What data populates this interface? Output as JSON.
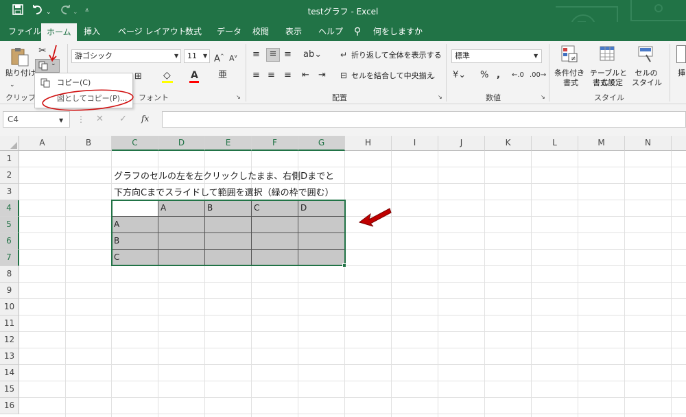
{
  "title": {
    "text": "testグラフ  -  Excel"
  },
  "quick_access": {
    "save_icon": "save-icon",
    "undo_icon": "undo-icon",
    "redo_icon": "redo-icon",
    "customize_icon": "customize-icon"
  },
  "tabs": [
    {
      "label": "ファイル"
    },
    {
      "label": "ホーム"
    },
    {
      "label": "挿入"
    },
    {
      "label": "ページ レイアウト"
    },
    {
      "label": "数式"
    },
    {
      "label": "データ"
    },
    {
      "label": "校閲"
    },
    {
      "label": "表示"
    },
    {
      "label": "ヘルプ"
    },
    {
      "label": "何をしますか"
    }
  ],
  "ribbon": {
    "clipboard": {
      "paste_label": "貼り付け",
      "group_label": "クリップボード"
    },
    "font": {
      "font_name": "游ゴシック",
      "font_size": "11",
      "group_label": "フォント"
    },
    "alignment": {
      "wrap_label": "折り返して全体を表示する",
      "merge_label": "セルを結合して中央揃え",
      "group_label": "配置"
    },
    "number": {
      "format": "標準",
      "group_label": "数値",
      "percent": "%",
      "comma": ","
    },
    "styles": {
      "conditional_label_1": "条件付き",
      "conditional_label_2": "書式",
      "table_label_1": "テーブルとして",
      "table_label_2": "書式設定",
      "cell_style_label_1": "セルの",
      "cell_style_label_2": "スタイル",
      "group_label": "スタイル",
      "insert_label": "挿"
    }
  },
  "copy_menu": {
    "items": [
      {
        "label": "コピー(C)"
      },
      {
        "label": "図としてコピー(P)..."
      }
    ]
  },
  "formula_bar": {
    "name_box": "C4",
    "fx": "fx",
    "cancel": "✕",
    "confirm": "✓",
    "value": ""
  },
  "columns": [
    "A",
    "B",
    "C",
    "D",
    "E",
    "F",
    "G",
    "H",
    "I",
    "J",
    "K",
    "L",
    "M",
    "N"
  ],
  "rows": [
    "1",
    "2",
    "3",
    "4",
    "5",
    "6",
    "7",
    "8",
    "9",
    "10",
    "11",
    "12",
    "13",
    "14",
    "15",
    "16"
  ],
  "sheet": {
    "instruction_line1": "グラフのセルの左を左クリックしたまま、右側Dまでと",
    "instruction_line2": "下方向Cまでスライドして範囲を選択（緑の枠で囲む）",
    "table_header": [
      "",
      "A",
      "B",
      "C",
      "D"
    ],
    "table_rows": [
      {
        "label": "A",
        "values": [
          "",
          "",
          "",
          ""
        ]
      },
      {
        "label": "B",
        "values": [
          "",
          "",
          "",
          ""
        ]
      },
      {
        "label": "C",
        "values": [
          "",
          "",
          "",
          ""
        ]
      }
    ]
  },
  "colors": {
    "excel_green": "#217346",
    "selection_fill": "#c8c8c8",
    "arrow_red": "#c00000"
  }
}
